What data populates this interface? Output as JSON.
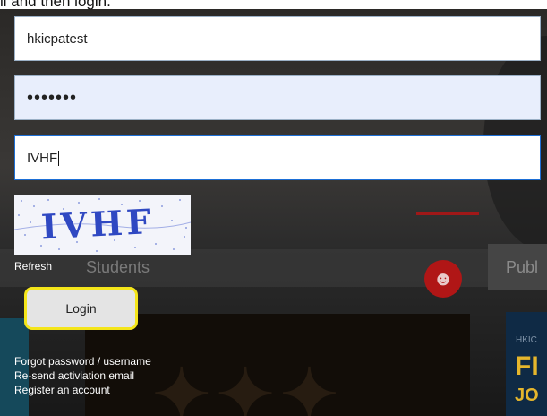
{
  "header_fragment": "il and then login.",
  "form": {
    "username_value": "hkicpatest",
    "password_mask": "•••••••",
    "captcha_value": "IVHF",
    "captcha_image_text": "IVHF",
    "refresh_label": "Refresh",
    "login_label": "Login"
  },
  "links": [
    {
      "label": "Forgot password / username"
    },
    {
      "label": "Re-send activiation email"
    },
    {
      "label": "Register an account"
    }
  ],
  "background": {
    "students_label": "Students",
    "publ_label": "Publ",
    "card_small": "HKIC",
    "card_big_1": "FI",
    "card_big_2": "JO"
  },
  "colors": {
    "login_highlight": "#f4e51a",
    "password_field_bg": "#e8eefc",
    "captcha_field_border": "#1d6fd6",
    "accent_red": "#b01616",
    "accent_gold": "#e5b62c"
  },
  "icons": {
    "background_badge": "person-icon"
  }
}
